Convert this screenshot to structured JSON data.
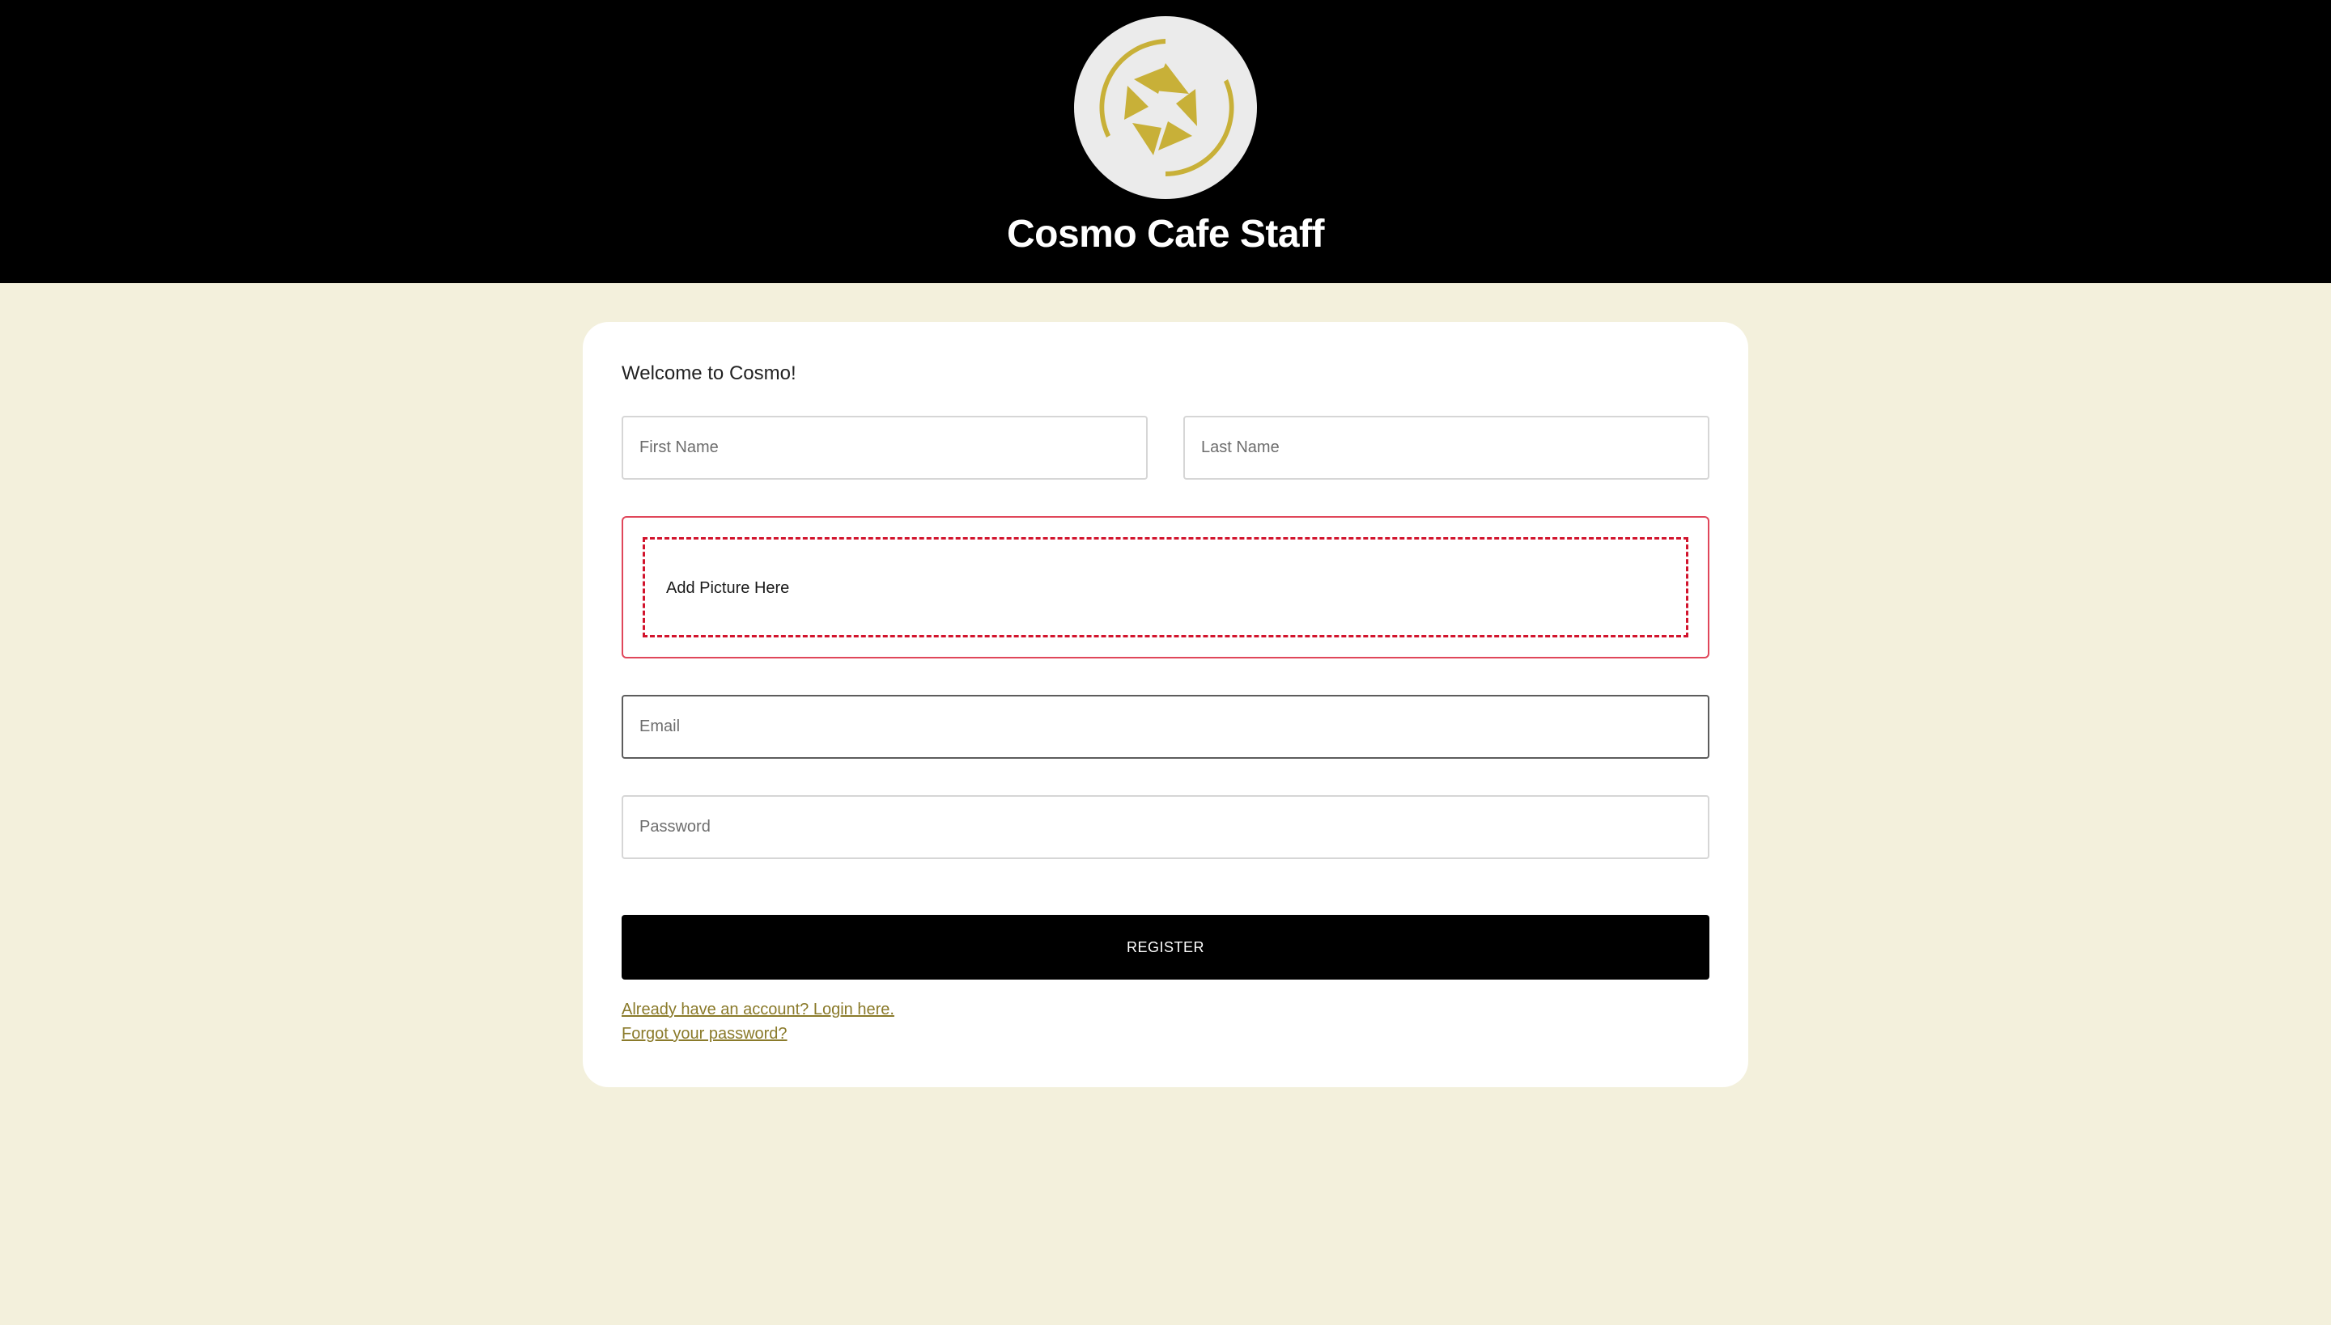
{
  "header": {
    "title": "Cosmo Cafe Staff",
    "logo_icon": "cosmo-logo-icon",
    "logo_color": "#c8b038",
    "background": "#000000"
  },
  "form": {
    "welcome": "Welcome to Cosmo!",
    "first_name_placeholder": "First Name",
    "last_name_placeholder": "Last Name",
    "picture_label": "Add Picture Here",
    "email_placeholder": "Email",
    "password_placeholder": "Password",
    "register_label": "REGISTER",
    "login_link": "Already have an account? Login here.",
    "forgot_link": "Forgot your password?"
  },
  "colors": {
    "page_background": "#f3f0dc",
    "upload_border": "#d2142d",
    "link": "#8a7a2a"
  }
}
